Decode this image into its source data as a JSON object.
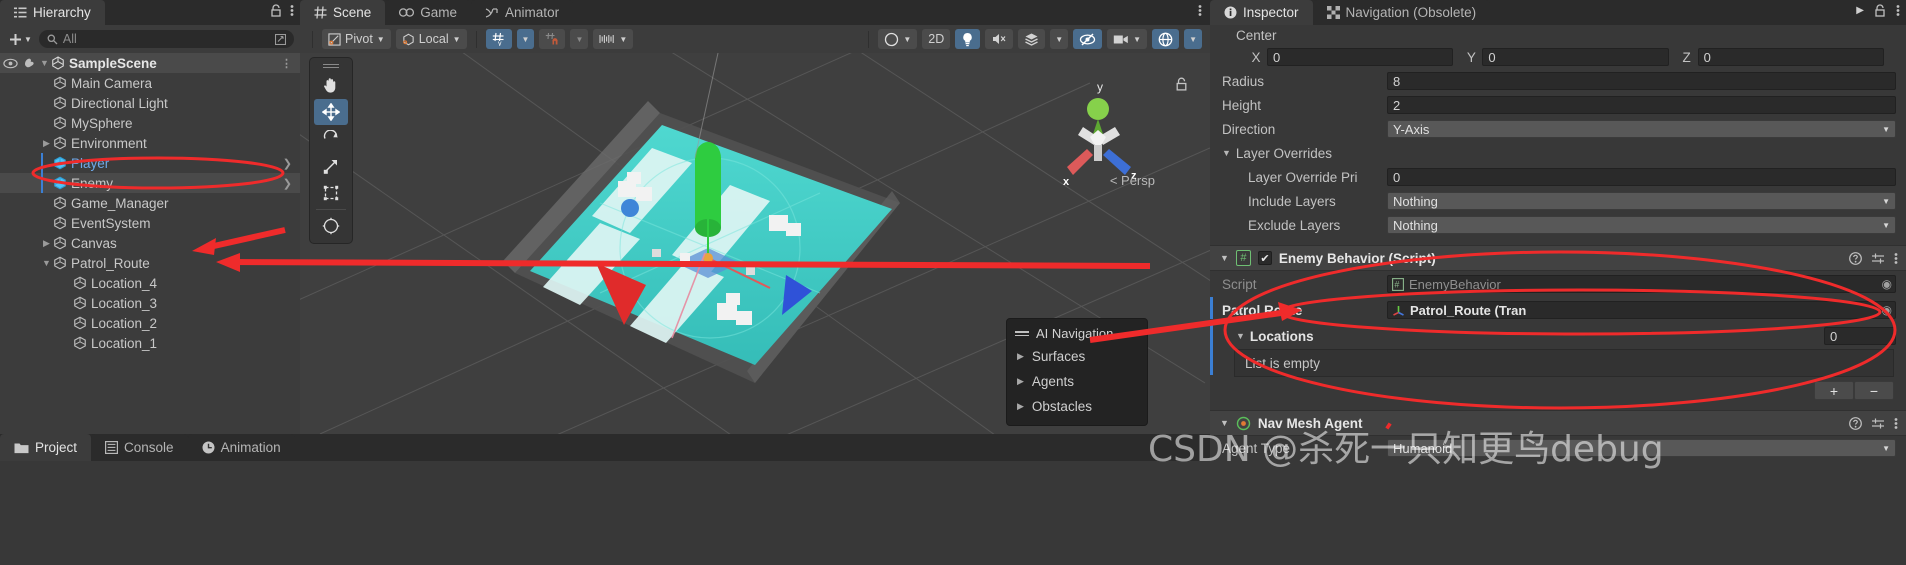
{
  "hierarchy": {
    "tab_label": "Hierarchy",
    "add_label": "+",
    "search_placeholder": "All",
    "search_value": "",
    "scene_name": "SampleScene",
    "items": [
      {
        "label": "Main Camera",
        "depth": 2,
        "twisty": "",
        "selected": false,
        "blue_icon": false,
        "blue_text": false,
        "chevron": false
      },
      {
        "label": "Directional Light",
        "depth": 2,
        "twisty": "",
        "selected": false,
        "blue_icon": false,
        "blue_text": false,
        "chevron": false
      },
      {
        "label": "MySphere",
        "depth": 2,
        "twisty": "",
        "selected": false,
        "blue_icon": false,
        "blue_text": false,
        "chevron": false
      },
      {
        "label": "Environment",
        "depth": 2,
        "twisty": "▶",
        "selected": false,
        "blue_icon": false,
        "blue_text": false,
        "chevron": false
      },
      {
        "label": "Player",
        "depth": 2,
        "twisty": "",
        "selected": false,
        "blue_icon": true,
        "blue_text": true,
        "chevron": true
      },
      {
        "label": "Enemy",
        "depth": 2,
        "twisty": "",
        "selected": true,
        "blue_icon": true,
        "blue_text": false,
        "chevron": true
      },
      {
        "label": "Game_Manager",
        "depth": 2,
        "twisty": "",
        "selected": false,
        "blue_icon": false,
        "blue_text": false,
        "chevron": false
      },
      {
        "label": "EventSystem",
        "depth": 2,
        "twisty": "",
        "selected": false,
        "blue_icon": false,
        "blue_text": false,
        "chevron": false
      },
      {
        "label": "Canvas",
        "depth": 2,
        "twisty": "▶",
        "selected": false,
        "blue_icon": false,
        "blue_text": false,
        "chevron": false
      },
      {
        "label": "Patrol_Route",
        "depth": 2,
        "twisty": "▼",
        "selected": false,
        "blue_icon": false,
        "blue_text": false,
        "chevron": false
      },
      {
        "label": "Location_4",
        "depth": 3,
        "twisty": "",
        "selected": false,
        "blue_icon": false,
        "blue_text": false,
        "chevron": false
      },
      {
        "label": "Location_3",
        "depth": 3,
        "twisty": "",
        "selected": false,
        "blue_icon": false,
        "blue_text": false,
        "chevron": false
      },
      {
        "label": "Location_2",
        "depth": 3,
        "twisty": "",
        "selected": false,
        "blue_icon": false,
        "blue_text": false,
        "chevron": false
      },
      {
        "label": "Location_1",
        "depth": 3,
        "twisty": "",
        "selected": false,
        "blue_icon": false,
        "blue_text": false,
        "chevron": false
      }
    ]
  },
  "scene": {
    "tabs": [
      {
        "label": "Scene",
        "icon": "grid-icon",
        "active": true
      },
      {
        "label": "Game",
        "icon": "gamepad-icon",
        "active": false
      },
      {
        "label": "Animator",
        "icon": "animator-icon",
        "active": false
      }
    ],
    "toolbar": {
      "pivot_label": "Pivot",
      "handle_label": "Local",
      "twod_label": "2D",
      "snap_label": "grid-snapping",
      "magnet_label": "surface-snap",
      "ruler_label": "grid-size"
    },
    "gizmo": {
      "axis_x": "x",
      "axis_y": "y",
      "axis_z": "z",
      "projection": "Persp"
    },
    "ai_navigation": {
      "title": "AI Navigation",
      "items": [
        "Surfaces",
        "Agents",
        "Obstacles"
      ]
    }
  },
  "inspector": {
    "tabs": [
      {
        "label": "Inspector",
        "icon": "info-icon",
        "active": true
      },
      {
        "label": "Navigation (Obsolete)",
        "icon": "navigation-icon",
        "active": false
      }
    ],
    "agent_fields": {
      "center_label": "Center",
      "center_x_axis": "X",
      "center_x": "0",
      "center_y_axis": "Y",
      "center_y": "0",
      "center_z_axis": "Z",
      "center_z": "0",
      "radius_label": "Radius",
      "radius": "8",
      "height_label": "Height",
      "height": "2",
      "direction_label": "Direction",
      "direction": "Y-Axis",
      "layer_overrides_label": "Layer Overrides",
      "layer_override_pri_label": "Layer Override Pri",
      "layer_override_pri": "0",
      "include_layers_label": "Include Layers",
      "include_layers": "Nothing",
      "exclude_layers_label": "Exclude Layers",
      "exclude_layers": "Nothing"
    },
    "enemy_behavior": {
      "title": "Enemy Behavior (Script)",
      "enabled": true,
      "script_label": "Script",
      "script_value": "EnemyBehavior",
      "patrol_route_label": "Patrol Route",
      "patrol_route_value": "Patrol_Route (Tran",
      "locations_label": "Locations",
      "locations_count": "0",
      "list_empty_text": "List is empty",
      "add_button": "+",
      "remove_button": "−"
    },
    "nav_mesh_agent": {
      "title": "Nav Mesh Agent",
      "agent_type_label": "Agent Type",
      "agent_type_value": "Humanoid"
    }
  },
  "bottom": {
    "tabs": [
      {
        "label": "Project",
        "icon": "folder-icon",
        "active": true
      },
      {
        "label": "Console",
        "icon": "console-icon",
        "active": false
      },
      {
        "label": "Animation",
        "icon": "clock-icon",
        "active": false
      }
    ]
  },
  "watermark": {
    "text": "CSDN @杀死一只知更鸟debug"
  },
  "colors": {
    "annotation_red": "#ef2b2b",
    "selection_blue": "#3b7fd4",
    "accent_blue": "#4a6d8e"
  }
}
